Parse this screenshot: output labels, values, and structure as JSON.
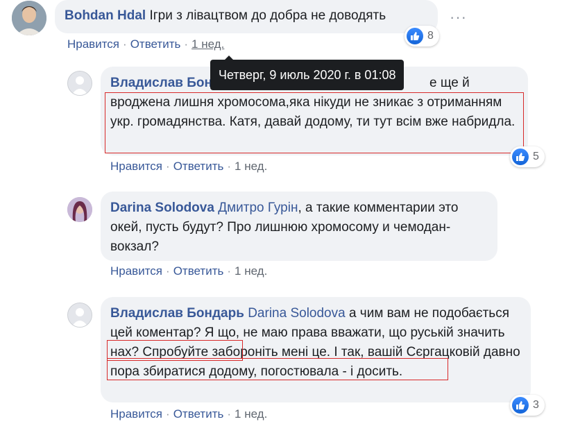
{
  "comments": [
    {
      "author": "Bohdan Hdal",
      "mention": "",
      "text": "Ігри з лівацтвом до добра не доводять",
      "actions": {
        "like": "Нравится",
        "reply": "Ответить",
        "time": "1 нед."
      },
      "reactions": "8"
    },
    {
      "author": "Владислав Бондарь",
      "mention": "",
      "text_line1_visible": "е ще й",
      "text_rest": "вроджена лишня хромосома,яка нікуди не зникає з отриманням укр. громадянства. Катя, давай додому, ти тут всім вже набридла.",
      "actions": {
        "like": "Нравится",
        "reply": "Ответить",
        "time": "1 нед."
      },
      "reactions": "5"
    },
    {
      "author": "Darina Solodova",
      "mention": "Дмитро Гурін",
      "text": ", а такие комментарии это окей, пусть будут? Про лишнюю хромосому и чемодан-вокзал?",
      "actions": {
        "like": "Нравится",
        "reply": "Ответить",
        "time": "1 нед."
      },
      "reactions": ""
    },
    {
      "author": "Владислав Бондарь",
      "mention": "Darina Solodova",
      "text": " а чим вам не подобається цей коментар? Я що, не маю права вважати, що руській значить нах? Спробуйте забороніть мені це. І так, вашій Сєргацковій давно пора збиратися додому, погостювала - і досить.",
      "actions": {
        "like": "Нравится",
        "reply": "Ответить",
        "time": "1 нед."
      },
      "reactions": "3"
    }
  ],
  "tooltip": "Четверг, 9 июль 2020 г. в 01:08",
  "more_options": "···",
  "colors": {
    "link": "#385898",
    "bubble": "#f0f2f5",
    "highlight": "#d82929",
    "like": "#1877f2"
  }
}
